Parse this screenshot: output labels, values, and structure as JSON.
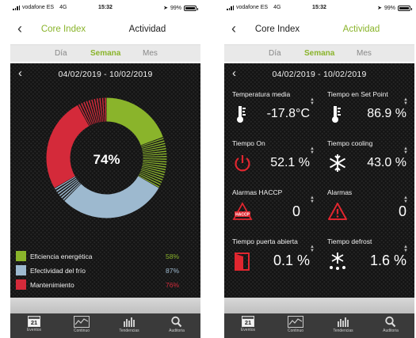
{
  "status": {
    "carrier": "vodafone ES",
    "network": "4G",
    "time": "15:32",
    "battery": "99%"
  },
  "nav": {
    "back_icon": "chevron-left-icon",
    "tab_core": "Core Index",
    "tab_actividad": "Actividad"
  },
  "segments": {
    "dia": "Día",
    "semana": "Semana",
    "mes": "Mes"
  },
  "date_range": "04/02/2019 - 10/02/2019",
  "colors": {
    "green": "#8ab42b",
    "blue": "#9db9cf",
    "red": "#d42a3a",
    "dark": "#141414"
  },
  "core_index": {
    "center_value": "74%",
    "chart_data": {
      "type": "pie",
      "categories": [
        "Eficiencia energética",
        "Efectividad del frío",
        "Mantenimiento"
      ],
      "values": [
        58,
        87,
        76
      ],
      "labels": [
        "58%",
        "87%",
        "76%"
      ]
    },
    "legend": [
      {
        "label": "Eficiencia energética",
        "value": "58%"
      },
      {
        "label": "Efectividad del frío",
        "value": "87%"
      },
      {
        "label": "Mantenimiento",
        "value": "76%"
      }
    ]
  },
  "actividad": {
    "metrics": [
      {
        "label": "Temperatura media",
        "value": "-17.8°C",
        "icon": "thermometer-icon"
      },
      {
        "label": "Tiempo en Set Point",
        "value": "86.9 %",
        "icon": "thermometer-icon"
      },
      {
        "label": "Tiempo On",
        "value": "52.1 %",
        "icon": "power-icon"
      },
      {
        "label": "Tiempo cooling",
        "value": "43.0 %",
        "icon": "snowflake-icon"
      },
      {
        "label": "Alarmas HACCP",
        "value": "0",
        "icon": "haccp-alarm-icon",
        "icon_text": "HACCP"
      },
      {
        "label": "Alarmas",
        "value": "0",
        "icon": "warning-icon"
      },
      {
        "label": "Tiempo puerta abierta",
        "value": "0.1 %",
        "icon": "door-icon"
      },
      {
        "label": "Tiempo defrost",
        "value": "1.6 %",
        "icon": "defrost-icon"
      }
    ]
  },
  "tabbar": [
    {
      "label": "Eventos",
      "icon": "calendar-icon",
      "icon_text": "21"
    },
    {
      "label": "Continuo",
      "icon": "line-chart-icon"
    },
    {
      "label": "Tendencias",
      "icon": "bar-chart-icon"
    },
    {
      "label": "Auditoria",
      "icon": "magnifier-icon"
    }
  ]
}
